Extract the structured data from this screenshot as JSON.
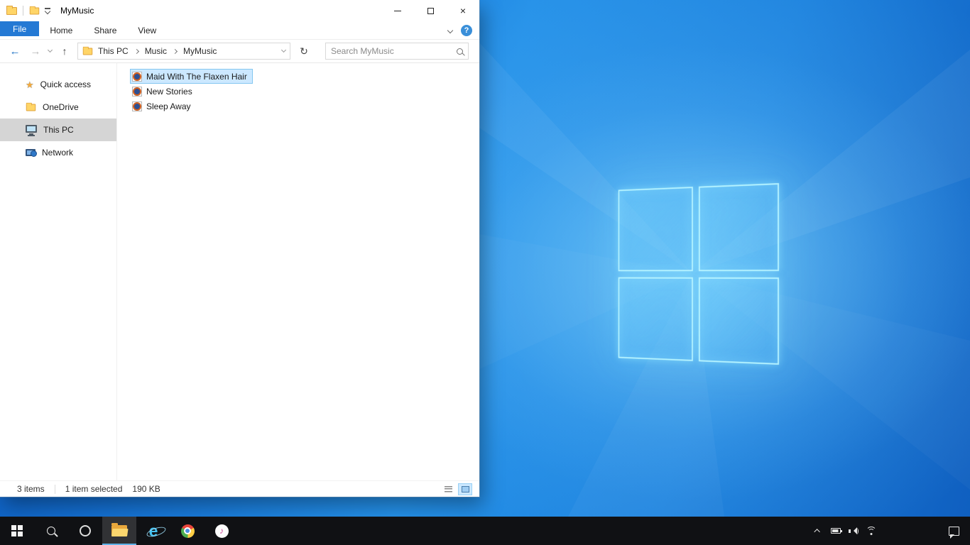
{
  "colors": {
    "accent_blue": "#2479d4",
    "selection_fill": "#cce8ff",
    "selection_border": "#84c7f0",
    "sidebar_selected_gray": "#d5d5d5",
    "taskbar_black": "#101114",
    "desktop_blue": "#1d82de",
    "folder_yellow": "#ffd567",
    "logo_glow_cyan": "#7ddcff"
  },
  "window": {
    "title": "MyMusic"
  },
  "ribbon": {
    "tabs": [
      {
        "label": "File",
        "active": true
      },
      {
        "label": "Home",
        "active": false
      },
      {
        "label": "Share",
        "active": false
      },
      {
        "label": "View",
        "active": false
      }
    ]
  },
  "navigation": {
    "breadcrumb": [
      "This PC",
      "Music",
      "MyMusic"
    ],
    "search": {
      "placeholder": "Search MyMusic",
      "value": ""
    }
  },
  "sidebar": {
    "items": [
      {
        "label": "Quick access",
        "icon": "star-icon",
        "selected": false
      },
      {
        "label": "OneDrive",
        "icon": "folder-icon",
        "selected": false
      },
      {
        "label": "This PC",
        "icon": "computer-icon",
        "selected": true
      },
      {
        "label": "Network",
        "icon": "network-icon",
        "selected": false
      }
    ]
  },
  "files": [
    {
      "name": "Maid With The Flaxen Hair",
      "icon": "audio-file-icon",
      "selected": true
    },
    {
      "name": "New Stories",
      "icon": "audio-file-icon",
      "selected": false
    },
    {
      "name": "Sleep Away",
      "icon": "audio-file-icon",
      "selected": false
    }
  ],
  "statusbar": {
    "items_count": "3 items",
    "selection": "1 item selected",
    "selection_size": "190 KB"
  },
  "taskbar": {
    "buttons": [
      "start",
      "search",
      "cortana",
      "file-explorer",
      "internet-explorer",
      "chrome",
      "itunes"
    ],
    "active_button": "file-explorer",
    "tray": [
      "tray-expand",
      "battery",
      "volume",
      "network",
      "action-center"
    ]
  },
  "glyphs": {
    "back": "←",
    "forward": "→",
    "up": "↑",
    "refresh": "↻",
    "close": "×",
    "help": "?",
    "star": "★",
    "ie_e": "e",
    "note": "♪"
  }
}
